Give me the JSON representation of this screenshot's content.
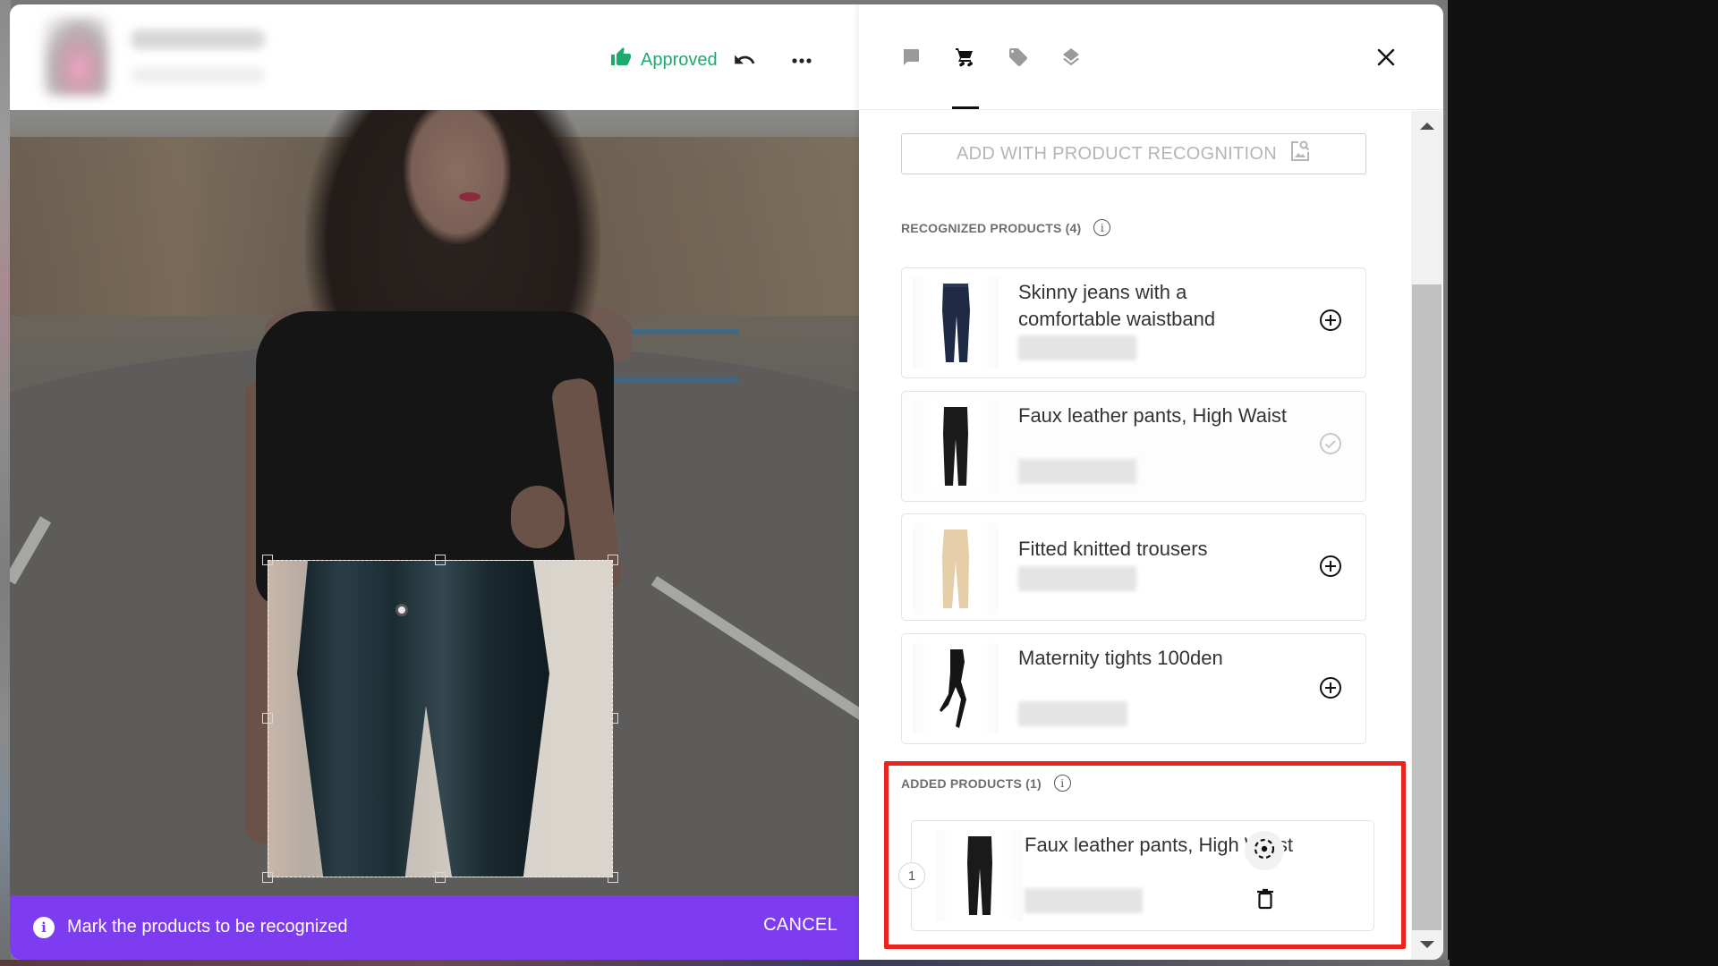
{
  "header": {
    "status_label": "Approved",
    "status_color": "#1daa6e",
    "icons": {
      "status": "thumbs-up-icon",
      "undo": "undo-icon",
      "more": "more-horizontal-icon"
    }
  },
  "hint_bar": {
    "message": "Mark the products to be recognized",
    "cancel_label": "CANCEL",
    "background": "#7d3cf0"
  },
  "tabs": [
    {
      "name": "comments",
      "icon": "chat-bubble-icon",
      "active": false
    },
    {
      "name": "products",
      "icon": "shopping-cart-icon",
      "active": true
    },
    {
      "name": "tags",
      "icon": "tag-icon",
      "active": false
    },
    {
      "name": "layers",
      "icon": "layers-icon",
      "active": false
    }
  ],
  "panel": {
    "recognition_button_label": "ADD WITH PRODUCT RECOGNITION",
    "recognized_label": "RECOGNIZED PRODUCTS (4)",
    "added_label": "ADDED PRODUCTS (1)",
    "info_glyph": "i",
    "highlight_color": "#e8261d"
  },
  "recognized_products": [
    {
      "title": "Skinny jeans with a comfortable waistband",
      "action": "add",
      "thumb": "dark-blue-jeans"
    },
    {
      "title": "Faux leather pants, High Waist",
      "action": "added-check",
      "thumb": "black-leather-pants"
    },
    {
      "title": "Fitted knitted trousers",
      "action": "add",
      "thumb": "beige-trousers"
    },
    {
      "title": "Maternity tights 100den",
      "action": "add",
      "thumb": "black-tights"
    }
  ],
  "added_products": [
    {
      "index": "1",
      "title": "Faux leather pants, High Waist",
      "thumb": "black-leather-pants"
    }
  ]
}
